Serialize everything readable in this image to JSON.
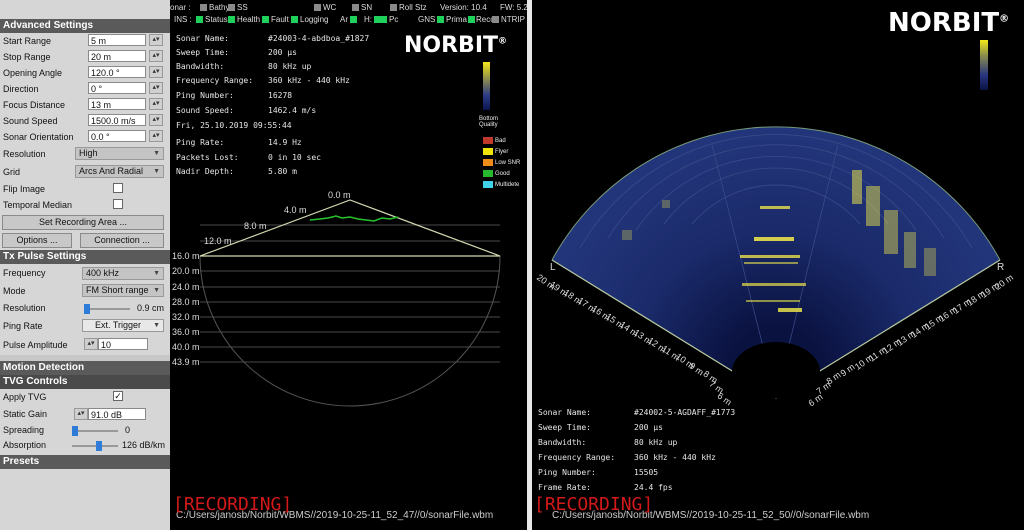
{
  "panel": {
    "advanced_title": "Advanced Settings",
    "advanced": [
      {
        "label": "Start Range",
        "value": "5 m"
      },
      {
        "label": "Stop Range",
        "value": "20 m"
      },
      {
        "label": "Opening Angle",
        "value": "120.0 °"
      },
      {
        "label": "Direction",
        "value": "0 °"
      },
      {
        "label": "Focus Distance",
        "value": "13 m"
      },
      {
        "label": "Sound Speed",
        "value": "1500.0 m/s"
      },
      {
        "label": "Sonar Orientation",
        "value": "0.0 °"
      }
    ],
    "resolution_label": "Resolution",
    "resolution_value": "High",
    "grid_label": "Grid",
    "grid_value": "Arcs And Radial",
    "flip_label": "Flip Image",
    "temporal_label": "Temporal Median",
    "set_recording": "Set Recording Area ...",
    "options": "Options ...",
    "connection": "Connection ...",
    "tx_title": "Tx Pulse Settings",
    "frequency_label": "Frequency",
    "frequency_value": "400 kHz",
    "mode_label": "Mode",
    "mode_value": "FM Short range",
    "tx_resolution_label": "Resolution",
    "tx_resolution_value": "0.9 cm",
    "ping_rate_label": "Ping Rate",
    "ping_rate_value": "Ext. Trigger",
    "pulse_amp_label": "Pulse Amplitude",
    "pulse_amp_value": "10",
    "motion_title": "Motion Detection",
    "tvg_title": "TVG Controls",
    "apply_tvg_label": "Apply TVG",
    "apply_tvg_check": "✓",
    "static_gain_label": "Static Gain",
    "static_gain_value": "91.0 dB",
    "spreading_label": "Spreading",
    "spreading_value": "0",
    "absorption_label": "Absorption",
    "absorption_value": "126 dB/km",
    "presets_title": "Presets"
  },
  "status": {
    "sonar": "onar :",
    "bathy": "Bathy",
    "ss": "SS",
    "wc": "WC",
    "sn": "SN",
    "roll": "Roll Stz",
    "version": "Version: 10.4",
    "fw": "FW: 5.2",
    "ins": "INS :",
    "status": "Status",
    "health": "Health",
    "fault": "Fault",
    "logging": "Logging",
    "ar": "Ar",
    "hr": "H:",
    "pc": "Pc",
    "gnss": "GNS",
    "prim": "Prima",
    "recon": "Recon",
    "ntrip": "NTRIP Cli",
    "green": "#1fd15a",
    "grey": "#8a8a8a"
  },
  "mid": {
    "info": [
      {
        "k": "Sonar Name:",
        "v": "#24003-4-abdboa_#1827"
      },
      {
        "k": "Sweep Time:",
        "v": "200 µs"
      },
      {
        "k": "Bandwidth:",
        "v": "80 kHz up"
      },
      {
        "k": "Frequency Range:",
        "v": "360 kHz - 440 kHz"
      },
      {
        "k": "Ping Number:",
        "v": "16278"
      },
      {
        "k": "Sound Speed:",
        "v": "1462.4 m/s"
      },
      {
        "k": "Fri, 25.10.2019 09:55:44",
        "v": ""
      },
      {
        "k": "Ping Rate:",
        "v": "14.9 Hz"
      },
      {
        "k": "Packets Lost:",
        "v": "0 in 10 sec"
      },
      {
        "k": "Nadir Depth:",
        "v": "5.80 m"
      }
    ],
    "logo": "NORBIT",
    "logo_mark": "®",
    "quality_title": "Bottom Quality",
    "legend": [
      {
        "label": "Bad",
        "color": "#c0392b"
      },
      {
        "label": "Flyer",
        "color": "#f1e40a"
      },
      {
        "label": "Low SNR",
        "color": "#f08c1a"
      },
      {
        "label": "Good",
        "color": "#27b82d"
      },
      {
        "label": "Multidete",
        "color": "#3fd2e8"
      }
    ],
    "depth_labels": [
      "0.0 m",
      "4.0 m",
      "8.0 m",
      "12.0 m",
      "16.0 m",
      "20.0 m",
      "24.0 m",
      "28.0 m",
      "32.0 m",
      "36.0 m",
      "40.0 m",
      "43.9 m"
    ],
    "recording": "[RECORDING]",
    "path": "C:/Users/janosb/Norbit/WBMS//2019-10-25-11_52_47//0/sonarFile.wbm"
  },
  "right": {
    "logo": "NORBIT",
    "logo_mark": "®",
    "left_marker": "L",
    "right_marker": "R",
    "left_ticks": [
      "20 m",
      "19 m",
      "18 m",
      "17 m",
      "16 m",
      "15 m",
      "14 m",
      "13 m",
      "12 m",
      "11 m",
      "10 m",
      "9 m",
      "8 m",
      "7 m",
      "6 m"
    ],
    "right_ticks": [
      "20 m",
      "19 m",
      "18 m",
      "17 m",
      "16 m",
      "15 m",
      "14 m",
      "13 m",
      "12 m",
      "11 m",
      "10 m",
      "9 m",
      "8 m",
      "7 m",
      "6 m"
    ],
    "info": [
      {
        "k": "Sonar Name:",
        "v": "#24002-5-AGDAFF_#1773"
      },
      {
        "k": "Sweep Time:",
        "v": "200 µs"
      },
      {
        "k": "Bandwidth:",
        "v": "80 kHz up"
      },
      {
        "k": "Frequency Range:",
        "v": "360 kHz - 440 kHz"
      },
      {
        "k": "Ping Number:",
        "v": "15505"
      },
      {
        "k": "Frame Rate:",
        "v": "24.4 fps"
      }
    ],
    "recording": "[RECORDING]",
    "path": "C:/Users/janosb/Norbit/WBMS//2019-10-25-11_52_50//0/sonarFile.wbm"
  }
}
